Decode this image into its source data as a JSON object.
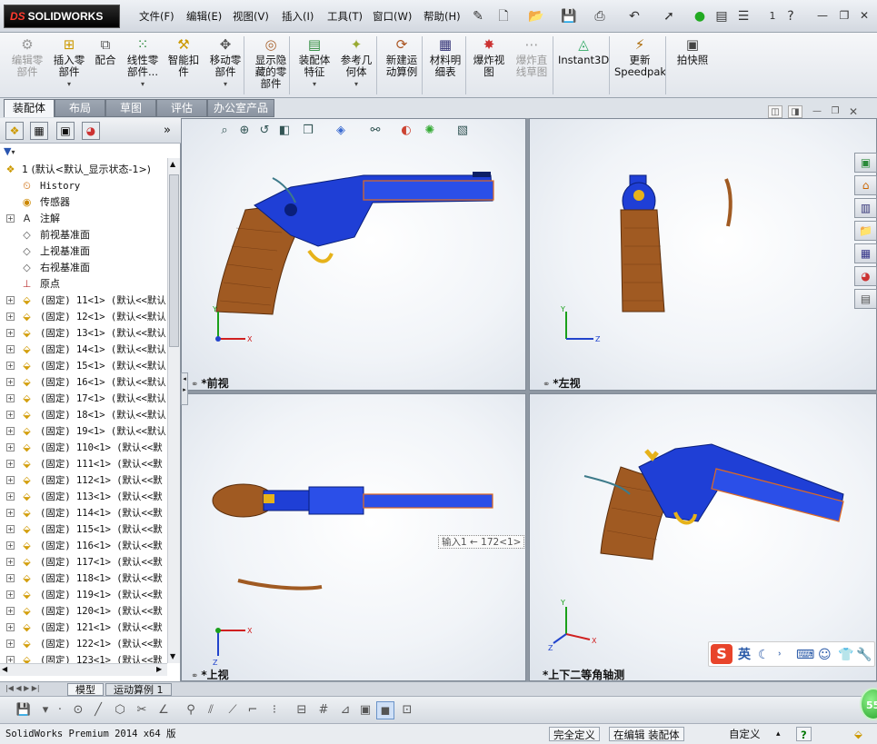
{
  "app": {
    "logo_prefix": "DS",
    "logo_text": "SOLIDWORKS",
    "menus": [
      "文件(F)",
      "编辑(E)",
      "视图(V)",
      "插入(I)",
      "工具(T)",
      "窗口(W)",
      "帮助(H)"
    ],
    "quick_number": "1",
    "quick_help": "?",
    "accent_color": "#1f3fd6",
    "wood_color": "#a05a22"
  },
  "ribbon": {
    "buttons": [
      {
        "label1": "编辑零",
        "label2": "部件",
        "icon": "edit-component-icon",
        "disabled": true
      },
      {
        "label1": "插入零",
        "label2": "部件",
        "icon": "insert-component-icon",
        "dropdown": true
      },
      {
        "label1": "配合",
        "label2": "",
        "icon": "mate-icon"
      },
      {
        "label1": "线性零",
        "label2": "部件...",
        "icon": "linear-pattern-icon",
        "dropdown": true
      },
      {
        "label1": "智能扣",
        "label2": "件",
        "icon": "smart-fastener-icon"
      },
      {
        "label1": "移动零",
        "label2": "部件",
        "icon": "move-component-icon",
        "dropdown": true
      },
      {
        "label1": "显示隐",
        "label2": "藏的零",
        "label3": "部件",
        "icon": "show-hidden-icon"
      },
      {
        "label1": "装配体",
        "label2": "特征",
        "icon": "assembly-feature-icon",
        "dropdown": true
      },
      {
        "label1": "参考几",
        "label2": "何体",
        "icon": "reference-geometry-icon",
        "dropdown": true
      },
      {
        "label1": "新建运",
        "label2": "动算例",
        "icon": "motion-study-icon"
      },
      {
        "label1": "材料明",
        "label2": "细表",
        "icon": "bom-icon"
      },
      {
        "label1": "爆炸视",
        "label2": "图",
        "icon": "explode-view-icon"
      },
      {
        "label1": "爆炸直",
        "label2": "线草图",
        "icon": "explode-line-icon",
        "disabled": true
      },
      {
        "label1": "Instant3D",
        "label2": "",
        "icon": "instant3d-icon"
      },
      {
        "label1": "更新",
        "label2": "Speedpak",
        "icon": "speedpak-icon"
      },
      {
        "label1": "拍快照",
        "label2": "",
        "icon": "snapshot-icon"
      }
    ]
  },
  "tabs": [
    "装配体",
    "布局",
    "草图",
    "评估",
    "办公室产品"
  ],
  "tree": {
    "filter_icon": "filter-icon",
    "root": "1  (默认<默认_显示状态-1>)",
    "nodes": [
      {
        "label": "History",
        "mono": true,
        "icon": "history-icon",
        "expand": false
      },
      {
        "label": "传感器",
        "icon": "sensor-icon",
        "expand": false
      },
      {
        "label": "注解",
        "icon": "annotation-icon",
        "expand": true
      },
      {
        "label": "前视基准面",
        "icon": "plane-icon",
        "expand": false
      },
      {
        "label": "上视基准面",
        "icon": "plane-icon",
        "expand": false
      },
      {
        "label": "右视基准面",
        "icon": "plane-icon",
        "expand": false
      },
      {
        "label": "原点",
        "icon": "origin-icon",
        "expand": false
      }
    ],
    "parts": [
      "(固定) 11<1> (默认<<默认",
      "(固定) 12<1> (默认<<默认",
      "(固定) 13<1> (默认<<默认",
      "(固定) 14<1> (默认<<默认",
      "(固定) 15<1> (默认<<默认",
      "(固定) 16<1> (默认<<默认",
      "(固定) 17<1> (默认<<默认",
      "(固定) 18<1> (默认<<默认",
      "(固定) 19<1> (默认<<默认",
      "(固定) 110<1> (默认<<默",
      "(固定) 111<1> (默认<<默",
      "(固定) 112<1> (默认<<默",
      "(固定) 113<1> (默认<<默",
      "(固定) 114<1> (默认<<默",
      "(固定) 115<1> (默认<<默",
      "(固定) 116<1> (默认<<默",
      "(固定) 117<1> (默认<<默",
      "(固定) 118<1> (默认<<默",
      "(固定) 119<1> (默认<<默",
      "(固定) 120<1> (默认<<默",
      "(固定) 121<1> (默认<<默",
      "(固定) 122<1> (默认<<默",
      "(固定) 123<1> (默认<<默"
    ]
  },
  "viewports": {
    "front": "*前视",
    "left": "*左视",
    "top": "*上视",
    "iso": "*上下二等角轴测"
  },
  "axes": {
    "x": "X",
    "y": "Y",
    "z": "Z"
  },
  "tooltip": "输入1 ← 172<1>",
  "bottom_tabs": [
    "模型",
    "运动算例 1"
  ],
  "ime": {
    "logo": "S",
    "lang": "英"
  },
  "status": {
    "product": "SolidWorks Premium 2014 x64 版",
    "definition": "完全定义",
    "editing": "在编辑 装配体",
    "units": "自定义",
    "help": "?"
  },
  "badge": "55"
}
